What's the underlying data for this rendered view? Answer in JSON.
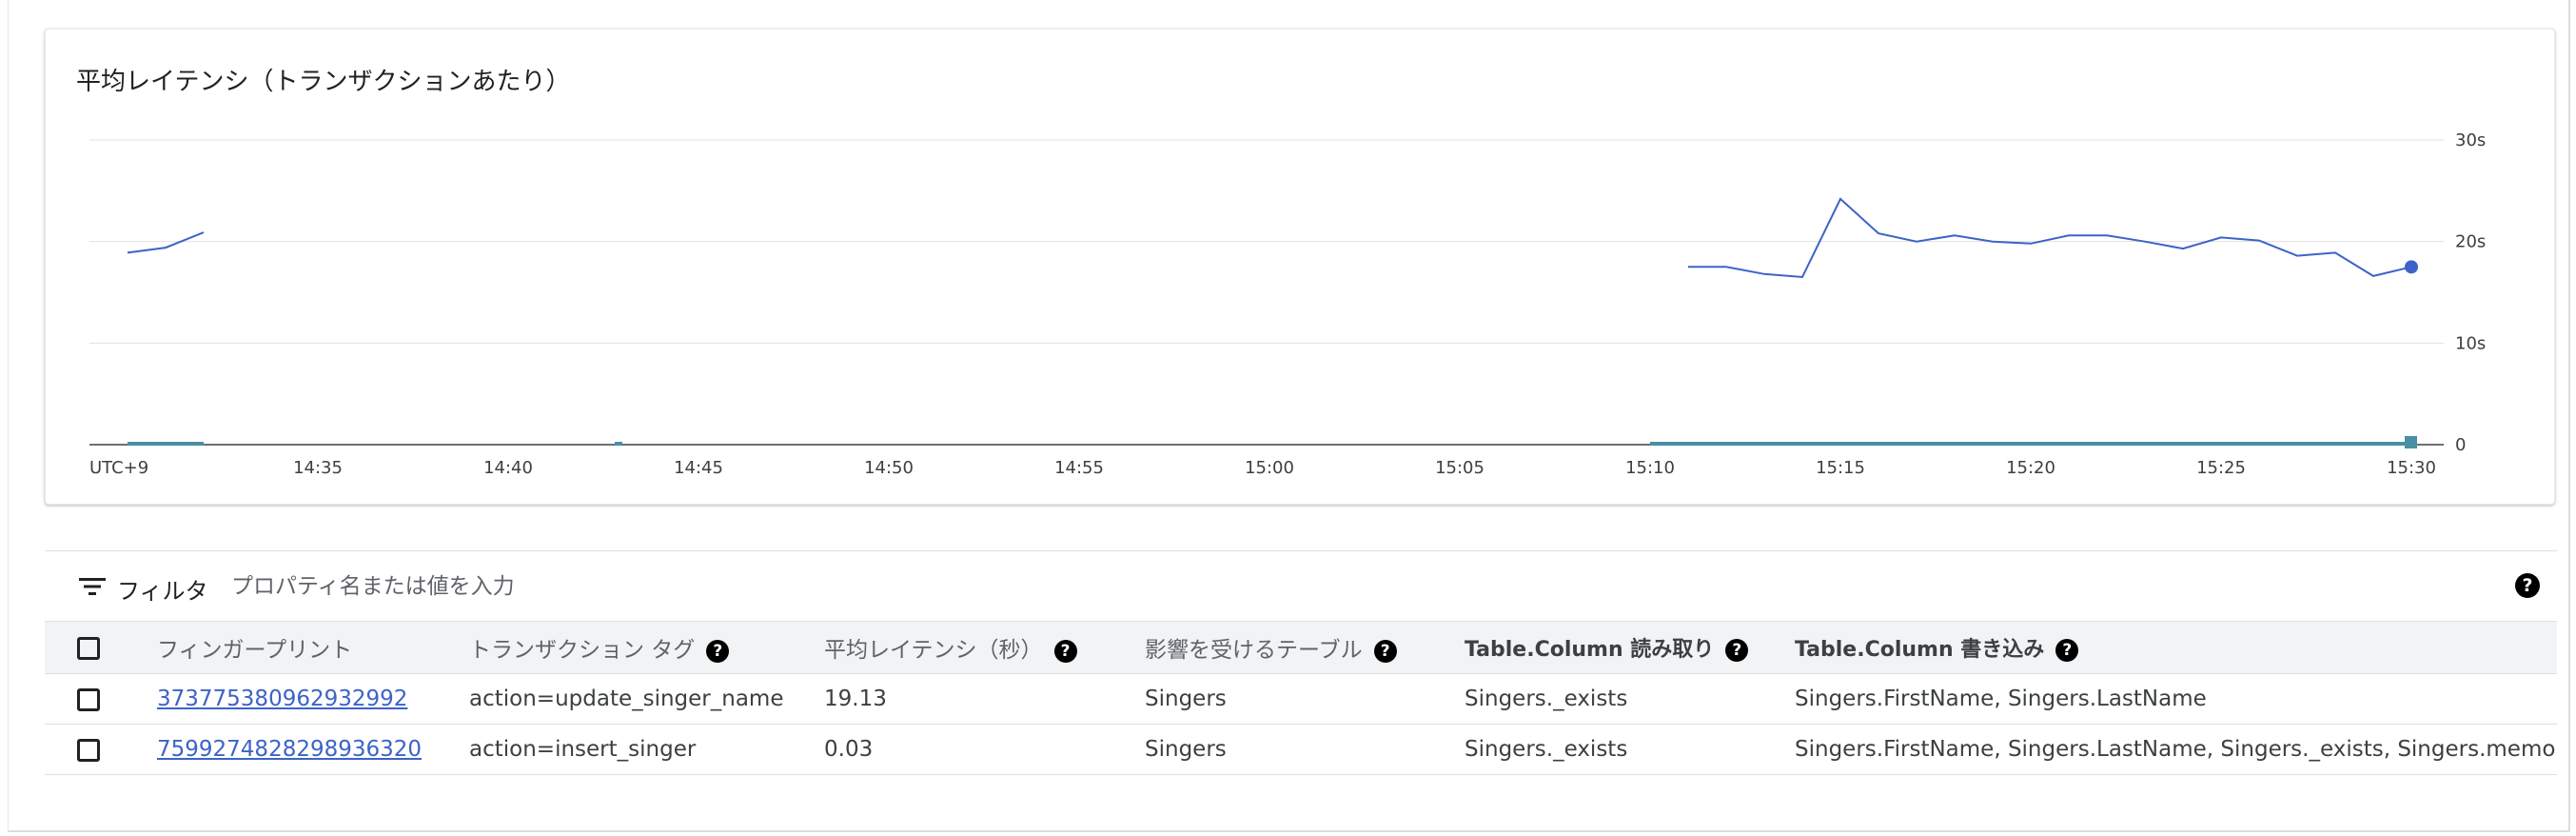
{
  "chart_card": {
    "title": "平均レイテンシ（トランザクションあたり）"
  },
  "chart_data": {
    "type": "line",
    "title": "平均レイテンシ（トランザクションあたり）",
    "xlabel": "",
    "ylabel": "",
    "timezone_label": "UTC+9",
    "x_ticks": [
      "14:35",
      "14:40",
      "14:45",
      "14:50",
      "14:55",
      "15:00",
      "15:05",
      "15:10",
      "15:15",
      "15:20",
      "15:25",
      "15:30"
    ],
    "y_ticks": [
      "0",
      "10s",
      "20s",
      "30s"
    ],
    "ylim": [
      0,
      30
    ],
    "xlim_minutes": [
      "14:30",
      "15:30"
    ],
    "grid": true,
    "series": [
      {
        "color": "#3c63c9",
        "segments": [
          [
            [
              "14:30",
              18.9
            ],
            [
              "14:31",
              19.4
            ],
            [
              "14:32",
              20.9
            ]
          ],
          [
            [
              "15:11",
              17.5
            ],
            [
              "15:12",
              17.5
            ],
            [
              "15:13",
              16.8
            ],
            [
              "15:14",
              16.5
            ],
            [
              "15:15",
              24.2
            ],
            [
              "15:16",
              20.8
            ],
            [
              "15:17",
              20.0
            ],
            [
              "15:18",
              20.6
            ],
            [
              "15:19",
              20.0
            ],
            [
              "15:20",
              19.8
            ],
            [
              "15:21",
              20.6
            ],
            [
              "15:22",
              20.6
            ],
            [
              "15:23",
              20.0
            ],
            [
              "15:24",
              19.3
            ],
            [
              "15:25",
              20.4
            ],
            [
              "15:26",
              20.1
            ],
            [
              "15:27",
              18.6
            ],
            [
              "15:28",
              18.9
            ],
            [
              "15:29",
              16.6
            ],
            [
              "15:30",
              17.5
            ]
          ]
        ]
      }
    ],
    "availability_bars": [
      {
        "color": "#4a90a4",
        "from": "14:30",
        "to": "14:32"
      },
      {
        "color": "#4a90a4",
        "from": "14:42.8",
        "to": "14:43"
      },
      {
        "color": "#4a90a4",
        "from": "15:10",
        "to": "15:30"
      }
    ]
  },
  "filter": {
    "label": "フィルタ",
    "placeholder": "プロパティ名または値を入力"
  },
  "table": {
    "headers": {
      "fingerprint": "フィンガープリント",
      "tag": "トランザクション タグ",
      "latency": "平均レイテンシ（秒）",
      "tables": "影響を受けるテーブル",
      "reads": "Table.Column 読み取り",
      "writes": "Table.Column 書き込み"
    },
    "rows": [
      {
        "fingerprint": "373775380962932992",
        "tag": "action=update_singer_name",
        "latency": "19.13",
        "tables": "Singers",
        "reads": "Singers._exists",
        "writes": "Singers.FirstName, Singers.LastName"
      },
      {
        "fingerprint": "7599274828298936320",
        "tag": "action=insert_singer",
        "latency": "0.03",
        "tables": "Singers",
        "reads": "Singers._exists",
        "writes": "Singers.FirstName, Singers.LastName, Singers._exists, Singers.memo"
      }
    ]
  },
  "icons": {
    "filter": "filter-list-icon",
    "help": "help-icon"
  },
  "colors": {
    "series_line": "#3c63c9",
    "availability": "#4a90a4",
    "link": "#3c63c9"
  }
}
